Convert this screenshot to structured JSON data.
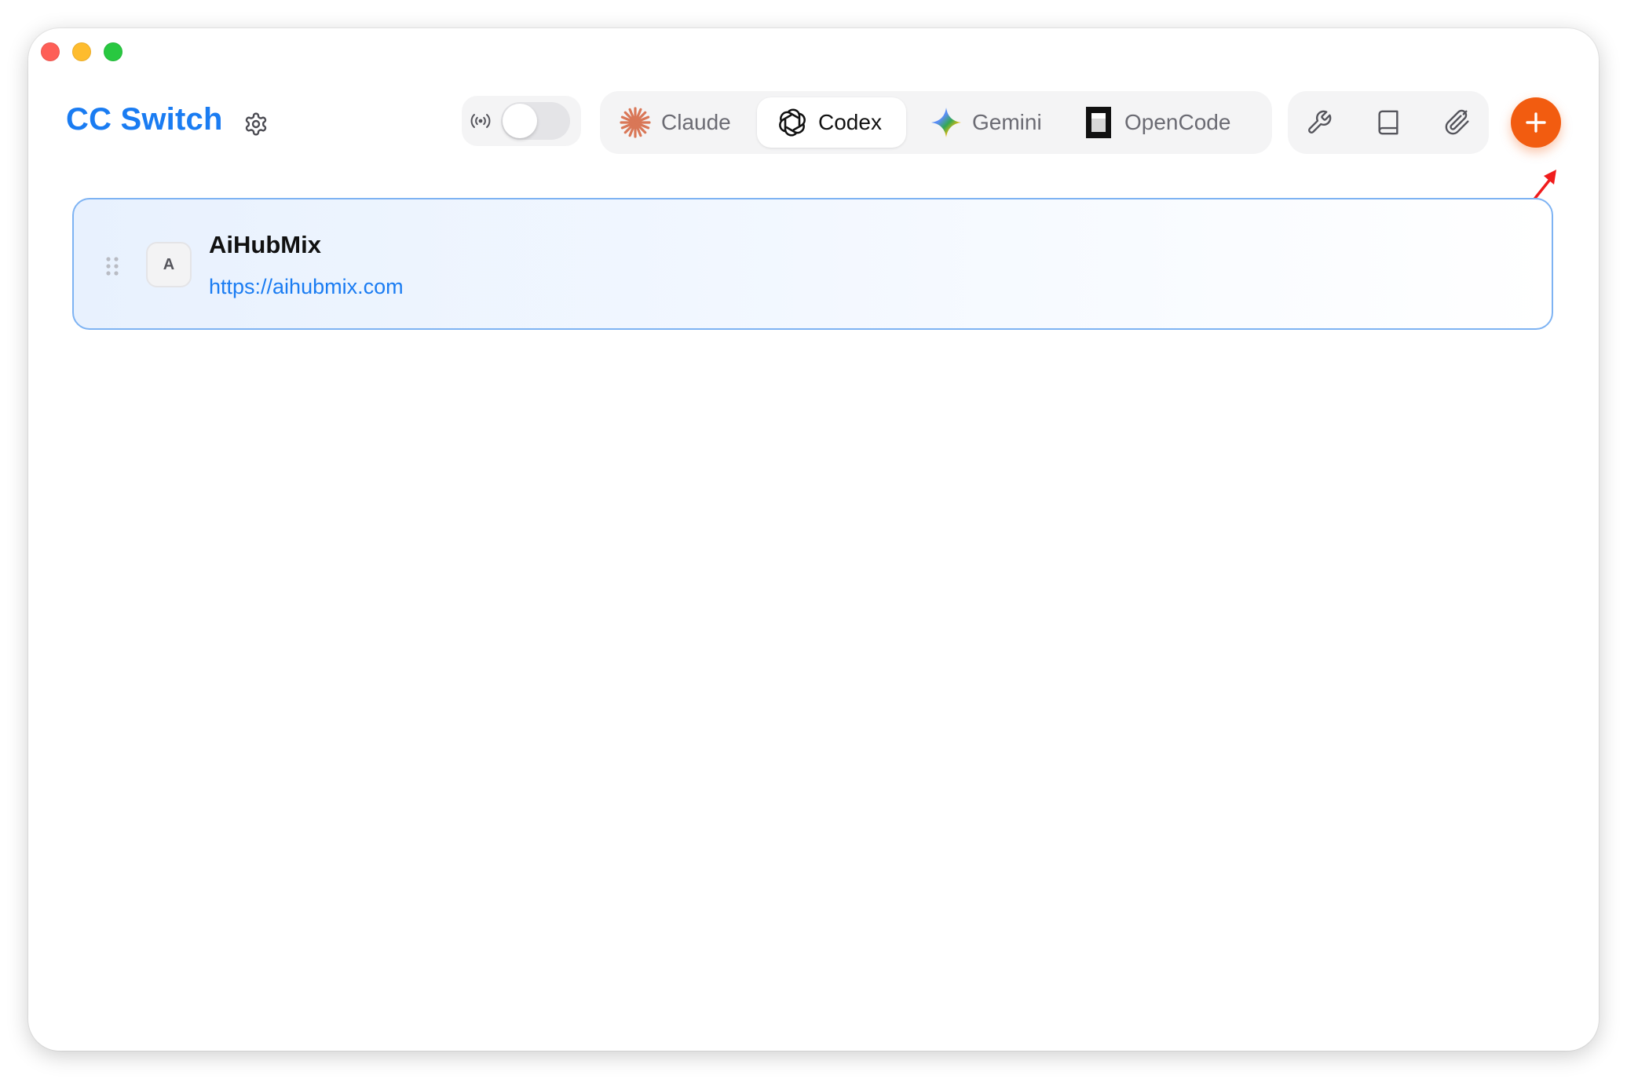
{
  "window": {
    "controls": [
      "close",
      "minimize",
      "zoom"
    ]
  },
  "header": {
    "title": "CC Switch",
    "settings_icon": "gear-icon",
    "proxy": {
      "icon": "broadcast-icon",
      "enabled": false
    },
    "app_tabs": [
      {
        "label": "Claude",
        "icon": "claude-icon",
        "active": false
      },
      {
        "label": "Codex",
        "icon": "openai-icon",
        "active": true
      },
      {
        "label": "Gemini",
        "icon": "gemini-icon",
        "active": false
      },
      {
        "label": "OpenCode",
        "icon": "opencode-icon",
        "active": false
      }
    ],
    "tools": [
      {
        "icon": "wrench-icon"
      },
      {
        "icon": "book-icon"
      },
      {
        "icon": "paperclip-icon"
      }
    ],
    "add_icon": "plus-icon"
  },
  "providers": [
    {
      "avatar": "A",
      "name": "AiHubMix",
      "url": "https://aihubmix.com"
    }
  ],
  "colors": {
    "accent": "#1a7cf2",
    "add_button": "#f25c10",
    "annotation": "#f01c1c",
    "card_border": "#7eb3f3"
  }
}
